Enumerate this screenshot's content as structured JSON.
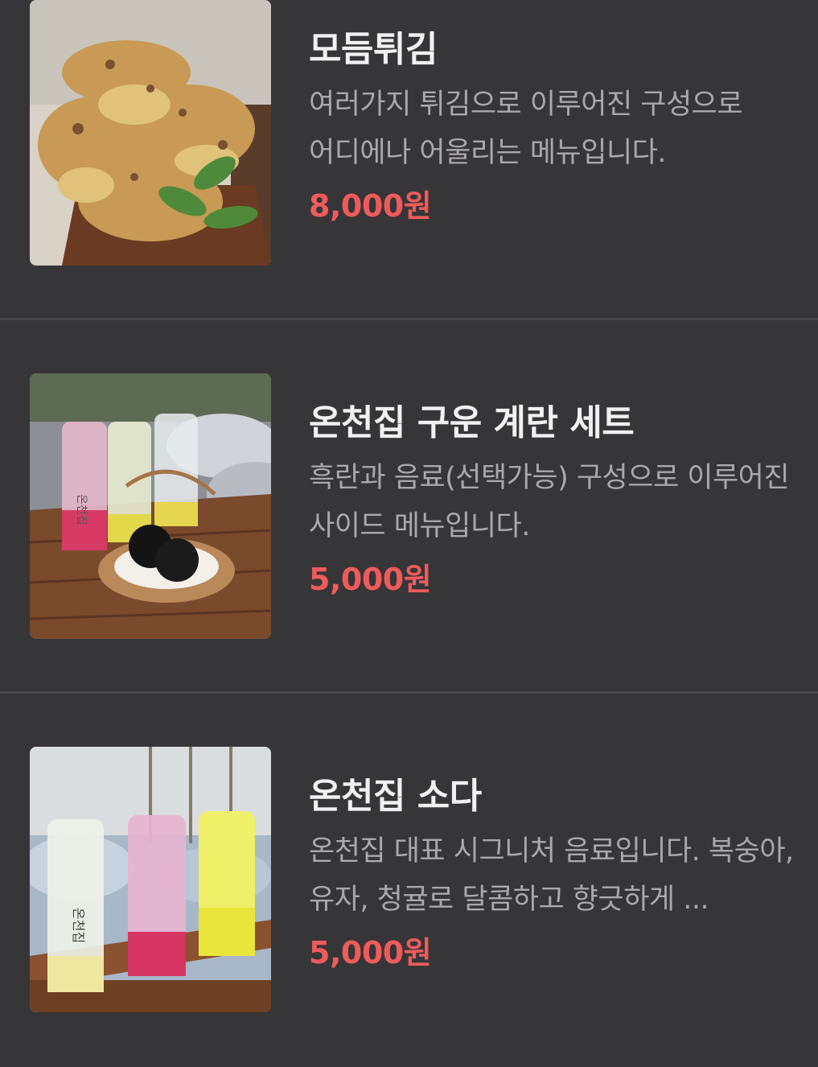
{
  "menu": {
    "items": [
      {
        "name": "모듬튀김",
        "description": "여러가지 튀김으로 이루어진 구성으로 어디에나 어울리는 메뉴입니다.",
        "price": "8,000원",
        "photo_text": ""
      },
      {
        "name": "온천집 구운 계란 세트",
        "description": "흑란과 음료(선택가능) 구성으로 이루어진 사이드 메뉴입니다.",
        "price": "5,000원",
        "photo_text": "온천집"
      },
      {
        "name": "온천집 소다",
        "description": "온천집 대표 시그니처 음료입니다. 복숭아, 유자, 청귤로 달콤하고 향긋하게 ...",
        "price": "5,000원",
        "photo_text": "온천집"
      }
    ]
  },
  "colors": {
    "background": "#363538",
    "divider": "#48474b",
    "title": "#f1f1f1",
    "description": "#a9a8ad",
    "price": "#ef5b5b"
  }
}
